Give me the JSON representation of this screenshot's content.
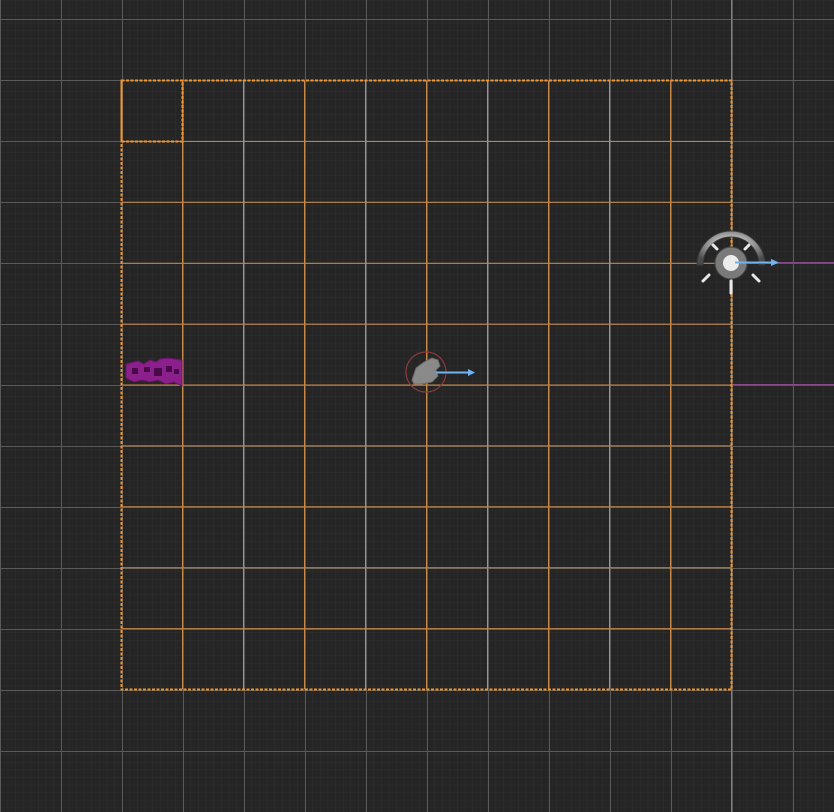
{
  "viewport": {
    "mode": "2d-scene",
    "background": "#252525",
    "major_grid_color": "#5a5a5a",
    "minor_grid_color": "#2d2d2d",
    "selection_color": "#f0952f",
    "axis_y_color": "#5a9a5a",
    "axis_x_color": "#8a4a8a",
    "gizmo_arrow_color": "#6fb3f2",
    "tile_count": 10
  },
  "objects": [
    {
      "name": "collision-shape",
      "icon": "collision-shape-icon",
      "color": "#8b1f8b"
    },
    {
      "name": "character-sprite",
      "icon": "character-icon",
      "color": "#8a8a8a"
    },
    {
      "name": "light-source",
      "icon": "light-icon",
      "color": "#d0d0d0"
    }
  ]
}
